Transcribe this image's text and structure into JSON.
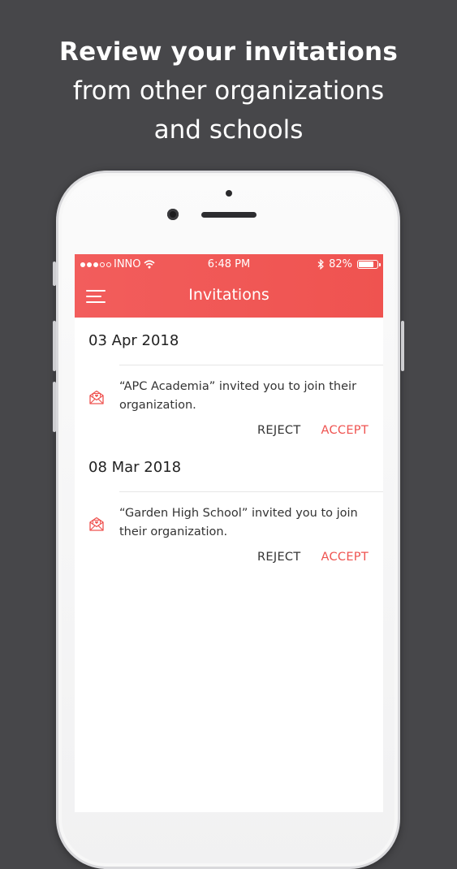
{
  "headline": {
    "line1": "Review your invitations",
    "line2": "from other organizations",
    "line3": "and schools"
  },
  "status_bar": {
    "carrier": "INNO",
    "time": "6:48 PM",
    "battery": "82%",
    "battery_level": 0.82,
    "signal_bars_filled": 3,
    "signal_bars_total": 5,
    "icons": [
      "wifi-icon",
      "bluetooth-icon",
      "battery-icon"
    ]
  },
  "app_bar": {
    "title": "Invitations",
    "menu_icon": "hamburger-menu-icon"
  },
  "colors": {
    "accent": "#ef5350",
    "background": "#47474a",
    "text": "#222222"
  },
  "invitations": [
    {
      "date": "03 Apr 2018",
      "icon": "invitation-mail-icon",
      "message": "“APC Academia” invited you to join their organization.",
      "reject_label": "REJECT",
      "accept_label": "ACCEPT"
    },
    {
      "date": "08 Mar 2018",
      "icon": "invitation-mail-icon",
      "message": "“Garden High School” invited you to join their organization.",
      "reject_label": "REJECT",
      "accept_label": "ACCEPT"
    }
  ]
}
